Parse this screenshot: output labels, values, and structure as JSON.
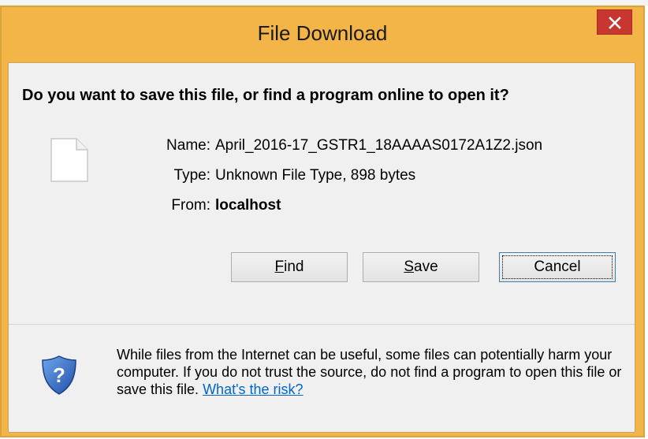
{
  "window": {
    "title": "File Download",
    "colors": {
      "titlebar": "#f3b448",
      "close": "#c7372f",
      "link": "#0066cc"
    }
  },
  "dialog": {
    "question": "Do you want to save this file, or find a program online to open it?",
    "file_icon": "blank-file-icon",
    "fields": {
      "name_label": "Name:",
      "name_value": "April_2016-17_GSTR1_18AAAAS0172A1Z2.json",
      "type_label": "Type:",
      "type_value": "Unknown File Type, 898 bytes",
      "from_label": "From:",
      "from_value": "localhost"
    },
    "buttons": {
      "find_mnemonic": "F",
      "find_rest": "ind",
      "save_mnemonic": "S",
      "save_rest": "ave",
      "cancel": "Cancel"
    },
    "warning": {
      "icon": "security-shield-question-icon",
      "text": "While files from the Internet can be useful, some files can potentially harm your computer. If you do not trust the source, do not find a program to open this file or save this file.",
      "link": "What's the risk?"
    }
  }
}
